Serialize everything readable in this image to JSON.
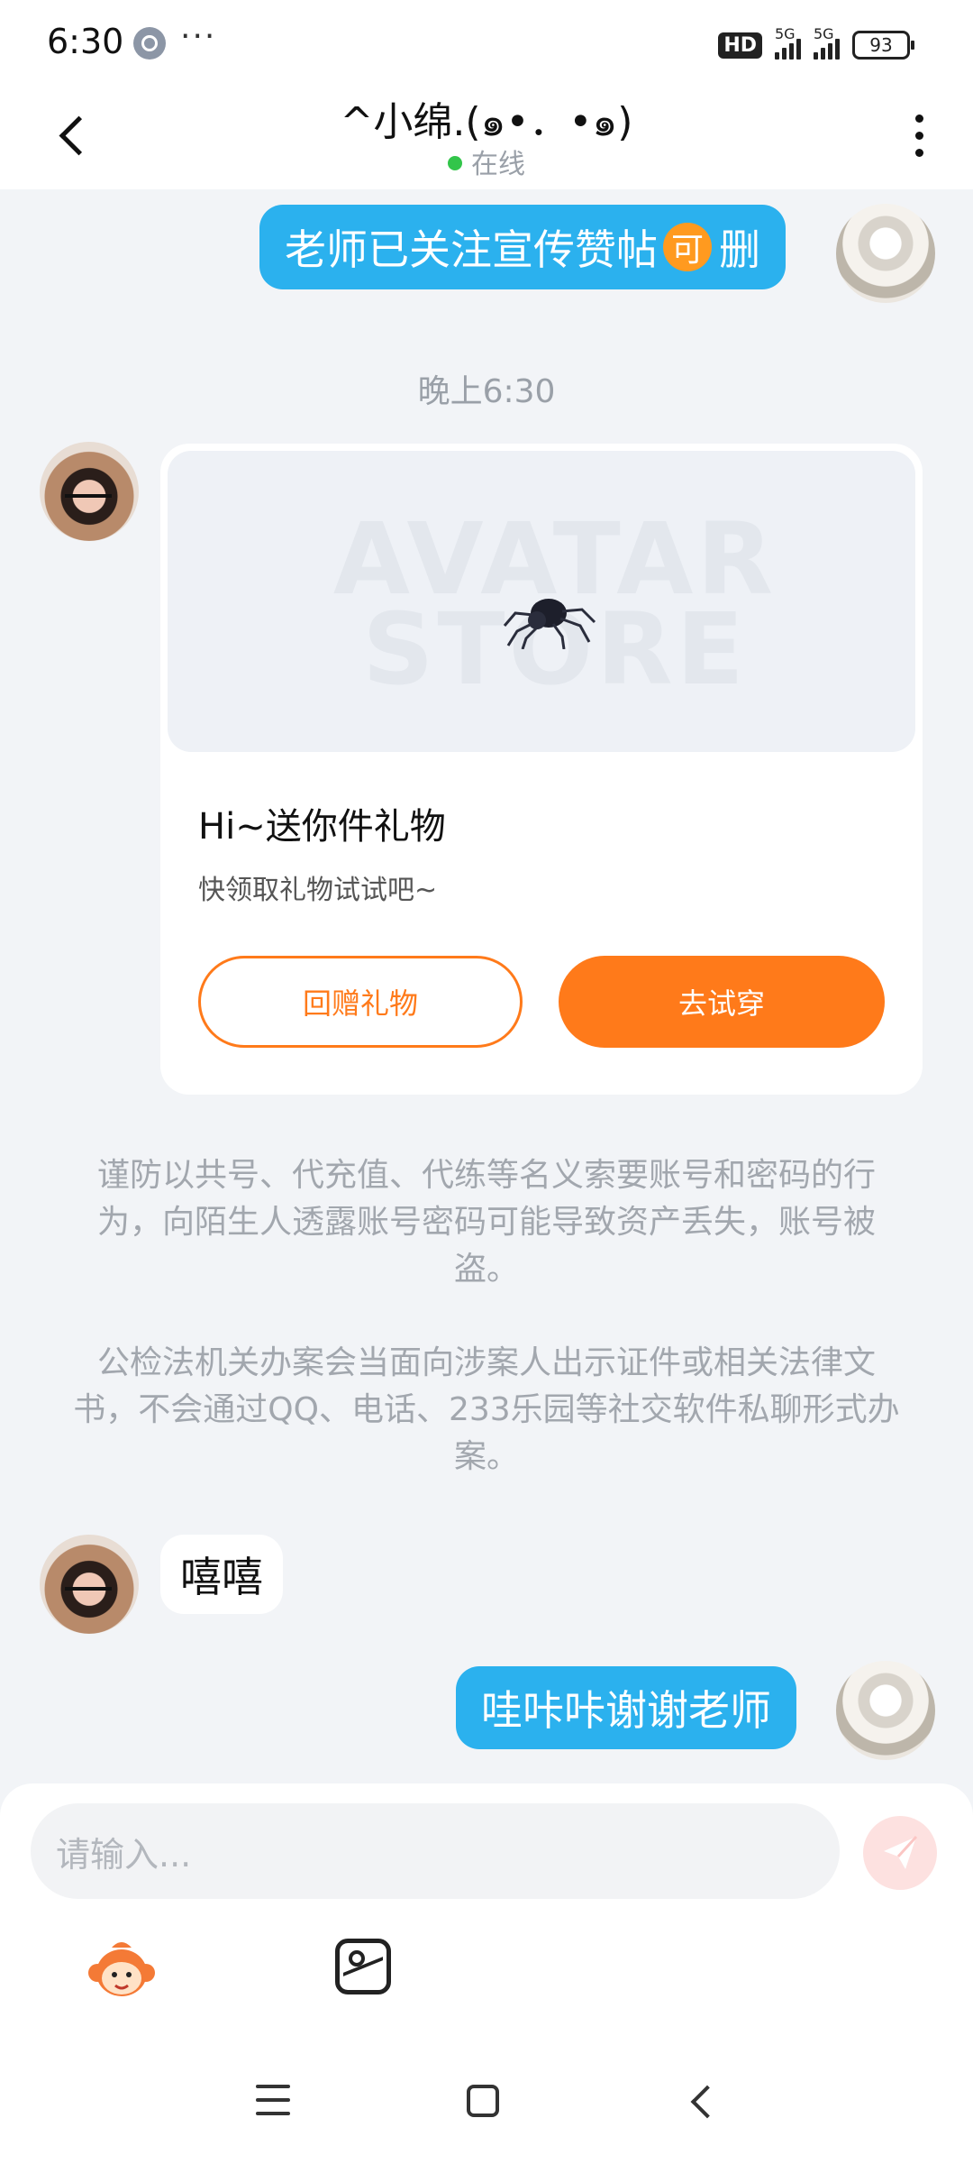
{
  "status_bar": {
    "time": "6:30",
    "more": "···",
    "hd": "HD",
    "sim1": "5G",
    "sim2": "5G",
    "battery": "93"
  },
  "header": {
    "title": "^小绵.(๑•．•๑)",
    "status": "在线"
  },
  "messages": {
    "msg1": {
      "prefix": "老师已关注宣传赞帖",
      "badge": "可",
      "suffix": "删"
    },
    "timestamp": "晚上6:30",
    "gift_card": {
      "image_watermark": [
        "AVATAR",
        "STORE"
      ],
      "title": "Hi~送你件礼物",
      "subtitle": "快领取礼物试试吧~",
      "return_gift": "回赠礼物",
      "try_on": "去试穿"
    },
    "notice1": "谨防以共号、代充值、代练等名义索要账号和密码的行为，向陌生人透露账号密码可能导致资产丢失，账号被盗。",
    "notice2": "公检法机关办案会当面向涉案人出示证件或相关法律文书，不会通过QQ、电话、233乐园等社交软件私聊形式办案。",
    "msg_in": "嘻嘻",
    "msg_out": "哇咔咔谢谢老师"
  },
  "input": {
    "placeholder": "请输入..."
  },
  "colors": {
    "bubble_out": "#2bb1ee",
    "accent_orange": "#ff7a1a",
    "online": "#32c54a"
  },
  "icons": [
    "back-arrow-icon",
    "more-vertical-icon",
    "spider-icon",
    "send-icon",
    "monkey-emoji-icon",
    "image-icon",
    "menu-icon",
    "home-icon",
    "back-icon"
  ]
}
